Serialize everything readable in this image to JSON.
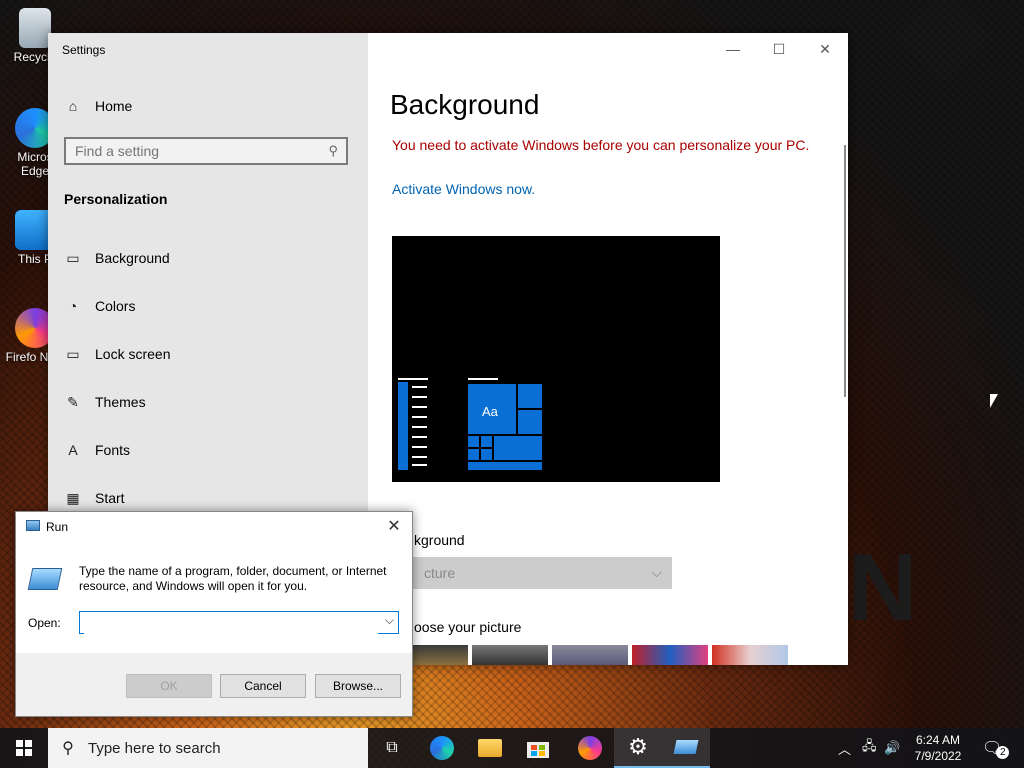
{
  "desktop": {
    "icons": [
      {
        "label": "Recycle",
        "icon": "recycle-bin-icon"
      },
      {
        "label": "Micros Edge",
        "icon": "edge-icon"
      },
      {
        "label": "This P",
        "icon": "this-pc-icon"
      },
      {
        "label": "Firefo Nigh",
        "icon": "firefox-nightly-icon"
      }
    ],
    "wallpaper_letter": "N"
  },
  "settings": {
    "title": "Settings",
    "home": "Home",
    "search_placeholder": "Find a setting",
    "section": "Personalization",
    "nav_items": [
      {
        "label": "Background",
        "icon": "image-icon"
      },
      {
        "label": "Colors",
        "icon": "palette-icon"
      },
      {
        "label": "Lock screen",
        "icon": "lock-screen-icon"
      },
      {
        "label": "Themes",
        "icon": "themes-icon"
      },
      {
        "label": "Fonts",
        "icon": "fonts-icon"
      },
      {
        "label": "Start",
        "icon": "start-icon"
      }
    ],
    "page_title": "Background",
    "warning": "You need to activate Windows before you can personalize your PC.",
    "activate_link": "Activate Windows now.",
    "preview_tile_text": "Aa",
    "background_label": "kground",
    "dropdown_value": "cture",
    "choose_label": "oose your picture",
    "colors": {
      "warning": "#a80000",
      "link": "#0063b1",
      "accent": "#0078d7"
    }
  },
  "run": {
    "title": "Run",
    "description": "Type the name of a program, folder, document, or Internet resource, and Windows will open it for you.",
    "open_label": "Open:",
    "open_value": "",
    "ok": "OK",
    "cancel": "Cancel",
    "browse": "Browse..."
  },
  "taskbar": {
    "search_placeholder": "Type here to search",
    "time": "6:24 AM",
    "date": "7/9/2022",
    "notifications": "2"
  }
}
